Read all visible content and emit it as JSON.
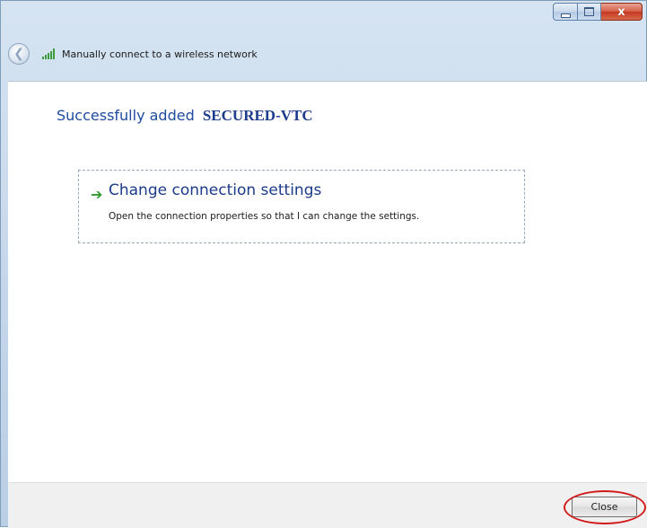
{
  "window": {
    "caption": {
      "close_glyph": "x"
    }
  },
  "nav": {
    "title": "Manually connect to a wireless network"
  },
  "main": {
    "heading_prefix": "Successfully added",
    "network_name": "SECURED-VTC",
    "option": {
      "title": "Change connection settings",
      "description": "Open the connection properties so that I can change the settings."
    }
  },
  "footer": {
    "close_label": "Close"
  },
  "colors": {
    "accent": "#1e4aa0",
    "arrow": "#2f9a2f",
    "highlight": "#d21c1c"
  },
  "icons": {
    "back": "back-arrow-icon",
    "wifi": "wireless-signal-icon",
    "option_arrow": "green-arrow-icon"
  }
}
